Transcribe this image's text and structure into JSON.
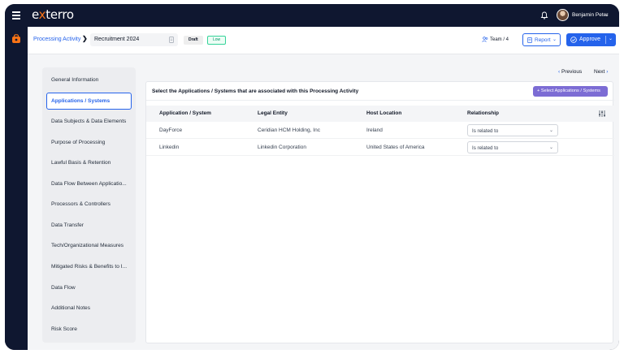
{
  "app": {
    "logo_text_pre": "e",
    "logo_text_x": "x",
    "logo_text_post": "terro",
    "user_name": "Benjamin Peter"
  },
  "icons": {
    "menu": "hamburger-menu-icon",
    "notification": "bell-icon",
    "rail": "privacy-module-icon",
    "edit": "edit-icon",
    "team": "team-icon",
    "report": "document-icon",
    "approve": "check-circle-icon",
    "column_settings": "sliders-icon",
    "plus": "plus-icon"
  },
  "colors": {
    "accent": "#2563eb",
    "brand_orange": "#f97316",
    "select_button": "#7c6cd4",
    "low_badge": "#34d399"
  },
  "header": {
    "breadcrumb": "Processing Activity",
    "breadcrumb_sep": "❯",
    "activity_title": "Recruitment 2024",
    "status_badge": "Draft",
    "risk_badge": "Low",
    "team": "Team / 4",
    "report_label": "Report",
    "approve_label": "Approve"
  },
  "sidebar": {
    "items": [
      {
        "label": "General Information",
        "active": false
      },
      {
        "label": "Applications / Systems",
        "active": true
      },
      {
        "label": "Data Subjects & Data Elements",
        "active": false
      },
      {
        "label": "Purpose of Processing",
        "active": false
      },
      {
        "label": "Lawful Basis & Retention",
        "active": false
      },
      {
        "label": "Data Flow Between Applicatio...",
        "active": false
      },
      {
        "label": "Processors & Controllers",
        "active": false
      },
      {
        "label": "Data Transfer",
        "active": false
      },
      {
        "label": "Tech/Organizational Measures",
        "active": false
      },
      {
        "label": "Mitigated Risks & Benefits to I...",
        "active": false
      },
      {
        "label": "Data Flow",
        "active": false
      },
      {
        "label": "Additional Notes",
        "active": false
      },
      {
        "label": "Risk Score",
        "active": false
      }
    ]
  },
  "pager": {
    "prev_label": "Previous",
    "next_label": "Next"
  },
  "panel": {
    "title": "Select the Applications / Systems that are associated with this Processing Activity",
    "select_button": "Select Applications / Systems"
  },
  "table": {
    "columns": [
      "Application / System",
      "Legal Entity",
      "Host Location",
      "Relationship"
    ],
    "rows": [
      {
        "application": "DayForce",
        "entity": "Ceridian HCM Holding, Inc",
        "location": "Ireland",
        "relationship": "Is related to"
      },
      {
        "application": "Linkedin",
        "entity": "Linkedin Corporation",
        "location": "United States of America",
        "relationship": "Is related to"
      }
    ]
  }
}
